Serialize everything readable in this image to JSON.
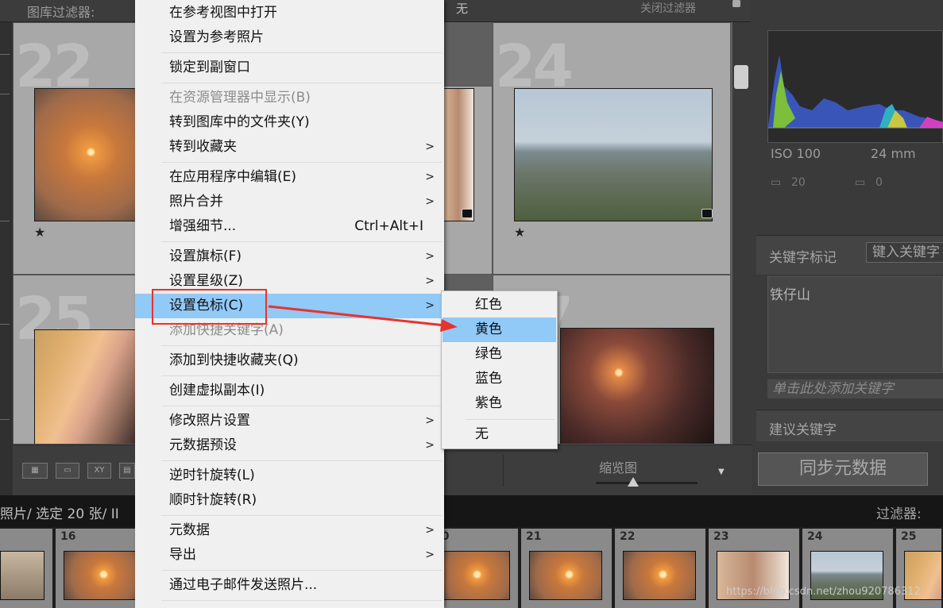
{
  "filter_bar": {
    "label": "图库过滤器:",
    "none_label": "无",
    "close_filters": "关闭过滤器"
  },
  "grid": {
    "cells": [
      {
        "number": "22",
        "rating": "★"
      },
      {
        "number": "24",
        "rating": "★"
      },
      {
        "number": "25"
      },
      {
        "number": "27"
      }
    ]
  },
  "toolbar": {
    "grid_view": "grid-view",
    "loupe_view": "loupe-view",
    "compare_view": "XY",
    "survey_view": "survey-view",
    "thumbnail_label": "缩览图",
    "thumbnail_size": 0.37
  },
  "right_panel": {
    "iso": "ISO 100",
    "focal": "24 mm",
    "row2_a": "20",
    "row2_b": "0",
    "keyword_tags_label": "关键字标记",
    "keyword_input_placeholder": "键入关键字",
    "keywords_text": "铁仔山",
    "add_keyword_hint": "单击此处添加关键字",
    "suggested_keywords": "建议关键字",
    "sync_metadata": "同步元数据"
  },
  "status_bar": {
    "text": "照片/ 选定 20 张/ II",
    "filter_label": "过滤器:"
  },
  "filmstrip": {
    "frames": [
      "",
      "16",
      "",
      "",
      "",
      "20",
      "21",
      "22",
      "23",
      "24",
      "25"
    ]
  },
  "watermark": "https://blog.csdn.net/zhou920786312",
  "context_menu": {
    "items": [
      {
        "label": "在参考视图中打开"
      },
      {
        "label": "设置为参考照片"
      },
      {
        "label": "锁定到副窗口"
      },
      {
        "label": "在资源管理器中显示(B)",
        "disabled": true
      },
      {
        "label": "转到图库中的文件夹(Y)"
      },
      {
        "label": "转到收藏夹",
        "submenu": true
      },
      {
        "label": "在应用程序中编辑(E)",
        "submenu": true
      },
      {
        "label": "照片合并",
        "submenu": true
      },
      {
        "label": "增强细节...",
        "shortcut": "Ctrl+Alt+I"
      },
      {
        "label": "设置旗标(F)",
        "submenu": true
      },
      {
        "label": "设置星级(Z)",
        "submenu": true
      },
      {
        "label": "设置色标(C)",
        "submenu": true,
        "highlighted": true
      },
      {
        "label": "添加快捷关键字(A)",
        "disabled": true
      },
      {
        "label": "添加到快捷收藏夹(Q)"
      },
      {
        "label": "创建虚拟副本(I)"
      },
      {
        "label": "修改照片设置",
        "submenu": true
      },
      {
        "label": "元数据预设",
        "submenu": true
      },
      {
        "label": "逆时针旋转(L)"
      },
      {
        "label": "顺时针旋转(R)"
      },
      {
        "label": "元数据",
        "submenu": true
      },
      {
        "label": "导出",
        "submenu": true
      },
      {
        "label": "通过电子邮件发送照片..."
      }
    ],
    "arrow_glyph": ">"
  },
  "color_label_submenu": {
    "items": [
      "红色",
      "黄色",
      "绿色",
      "蓝色",
      "紫色",
      "无"
    ],
    "highlighted": "黄色"
  },
  "annotation_color": "#e8322e"
}
